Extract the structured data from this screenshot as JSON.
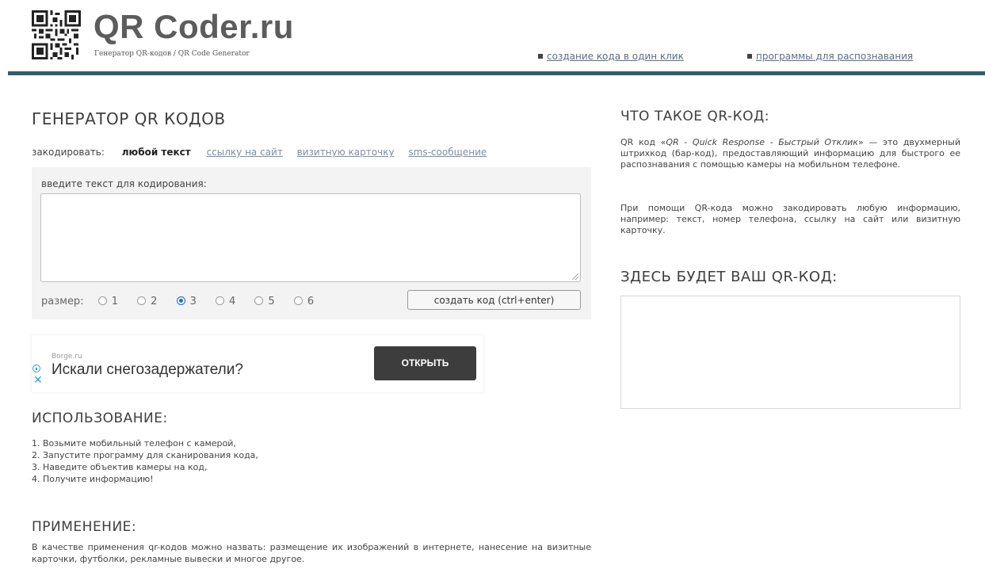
{
  "header": {
    "title": "QR Coder.ru",
    "subtitle": "Генератор QR-кодов / QR Code Generator",
    "links": [
      "создание кода в один клик",
      "программы для распознавания"
    ]
  },
  "generator": {
    "heading": "ГЕНЕРАТОР QR КОДОВ",
    "encode_label": "закодировать:",
    "encode_options": [
      "любой текст",
      "ссылку на сайт",
      "визитную карточку",
      "sms-сообщение"
    ],
    "encode_selected": "любой текст",
    "input_label": "введите текст для кодирования:",
    "input_value": "",
    "size_label": "размер:",
    "sizes": [
      "1",
      "2",
      "3",
      "4",
      "5",
      "6"
    ],
    "size_selected": "3",
    "create_button": "создать код (ctrl+enter)"
  },
  "ad": {
    "source": "Borge.ru",
    "title": "Искали снегозадержатели?",
    "button": "ОТКРЫТЬ"
  },
  "usage": {
    "heading": "ИСПОЛЬЗОВАНИЕ:",
    "steps": [
      "Возьмите мобильный телефон с камерой,",
      "Запустите программу для сканирования кода,",
      "Наведите объектив камеры на код,",
      "Получите информацию!"
    ]
  },
  "application": {
    "heading": "ПРИМЕНЕНИЕ:",
    "text": "В качестве применения qr-кодов можно назвать: размещение их изображений в интернете, нанесение на визитные карточки, футболки, рекламные вывески и многое другое."
  },
  "about": {
    "heading": "ЧТО ТАКОЕ QR-КОД:",
    "p1_start": "QR код «",
    "p1_italic": "QR - Quick Response - Быстрый Отклик",
    "p1_end": "» — это двухмерный штрихкод (бар-код), предоставляющий информацию для быстрого ее распознавания с помощью камеры на мобильном телефоне.",
    "p2": "При помощи QR-кода можно закодировать любую информацию, например: текст, номер телефона, ссылку на сайт или визитную карточку."
  },
  "result": {
    "heading": "ЗДЕСЬ БУДЕТ ВАШ QR-КОД:"
  },
  "colors": {
    "header_bar": "#2f5e70",
    "link": "#5a6f8a",
    "radio_checked": "#1f6fd0",
    "ad_button": "#3d3d3d"
  }
}
